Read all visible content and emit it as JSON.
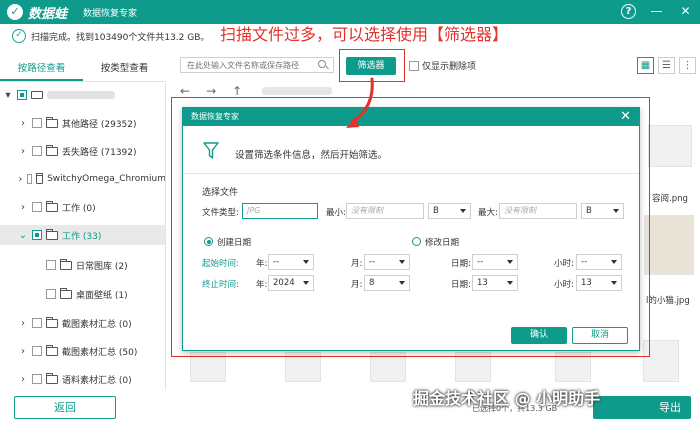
{
  "app": {
    "logo_glyph": "✓",
    "name": "数据蛙",
    "subtitle": "数据恢复专家",
    "help_glyph": "?",
    "minimize_glyph": "—",
    "close_glyph": "✕"
  },
  "status": {
    "check_glyph": "✓",
    "text": "扫描完成。找到103490个文件共13.2 GB。"
  },
  "callout": "扫描文件过多，可以选择使用【筛选器】",
  "tabs": [
    {
      "label": "按路径查看"
    },
    {
      "label": "按类型查看"
    }
  ],
  "toolbar": {
    "search_placeholder": "在此处输入文件名称或保存路径",
    "filter_label": "筛选器",
    "deleted_only_label": "仅显示删除项",
    "view_icons": [
      "▦",
      "☰",
      "⋮"
    ]
  },
  "nav": {
    "back": "←",
    "forward": "→",
    "up": "↑"
  },
  "tree": [
    {
      "label": "其他路径 (29352)"
    },
    {
      "label": "丢失路径 (71392)"
    },
    {
      "label": "SwitchyOmega_Chromium"
    },
    {
      "label": "工作 (0)"
    },
    {
      "label": "工作 (33)"
    },
    {
      "label": "日常图库 (2)"
    },
    {
      "label": "桌面壁纸 (1)"
    },
    {
      "label": "截图素材汇总 (0)"
    },
    {
      "label": "截图素材汇总 (50)"
    },
    {
      "label": "语料素材汇总 (0)"
    }
  ],
  "tree_chevrons": {
    "collapsed": "›",
    "expanded": "⌄"
  },
  "background_files": {
    "file1": "容阅.png",
    "file2": "l的小猫.jpg"
  },
  "dialog": {
    "title": "数据恢复专家",
    "close_glyph": "✕",
    "header_text": "设置筛选条件信息，然后开始筛选。",
    "section_label": "选择文件",
    "file_type_label": "文件类型:",
    "file_type_placeholder": "JPG",
    "min_label": "最小:",
    "min_placeholder": "没有限制",
    "min_unit": "B",
    "max_label": "最大:",
    "max_placeholder": "没有限制",
    "max_unit": "B",
    "created_date_label": "创建日期",
    "modified_date_label": "修改日期",
    "start_time_label": "起始时间:",
    "end_time_label": "终止时间:",
    "year_label": "年:",
    "month_label": "月:",
    "day_label": "日期:",
    "hour_label": "小时:",
    "start": {
      "year": "--",
      "month": "--",
      "day": "--",
      "hour": "--"
    },
    "end": {
      "year": "2024",
      "month": "8",
      "day": "13",
      "hour": "13"
    },
    "ok_label": "确认",
    "cancel_label": "取消"
  },
  "bottom": {
    "back_label": "返回",
    "recover_label": "导出",
    "info_text": "已选择0个，共13.3 GB"
  },
  "watermark": "掘金技术社区 @ 小明助手",
  "colors": {
    "brand": "#0e9b8c",
    "callout_red": "#e3322b"
  }
}
